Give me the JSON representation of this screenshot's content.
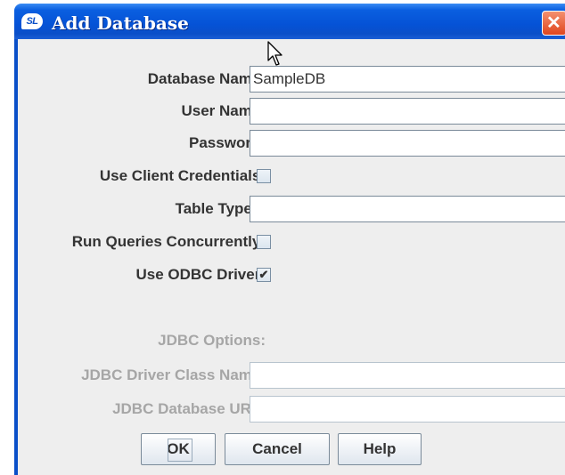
{
  "window": {
    "title": "Add Database",
    "icon_text": "SL",
    "icon_name": "app-icon",
    "close_icon": "close-icon"
  },
  "form": {
    "database_name": {
      "label": "Database Name:",
      "value": "SampleDB"
    },
    "user_name": {
      "label": "User Name:",
      "value": ""
    },
    "password": {
      "label": "Password:",
      "value": ""
    },
    "use_client_credentials": {
      "label": "Use Client Credentials:",
      "checked": false
    },
    "table_types": {
      "label": "Table Types:",
      "value": ""
    },
    "run_queries_concurrently": {
      "label": "Run Queries Concurrently:",
      "checked": false
    },
    "use_odbc_driver": {
      "label": "Use ODBC Driver:",
      "checked": true,
      "mark": "✔"
    },
    "jdbc_options": {
      "label": "JDBC Options:",
      "enabled": false
    },
    "jdbc_driver_class_name": {
      "label": "JDBC Driver Class Name:",
      "value": "",
      "enabled": false
    },
    "jdbc_database_url": {
      "label": "JDBC Database URL:",
      "value": "",
      "enabled": false
    }
  },
  "buttons": {
    "ok": "OK",
    "cancel": "Cancel",
    "help": "Help"
  },
  "colors": {
    "title_bar": "#0552d6",
    "dialog_bg": "#eeeeee",
    "label_text": "#333333",
    "disabled_text": "#a6a6a6",
    "close_button": "#e0461e"
  }
}
